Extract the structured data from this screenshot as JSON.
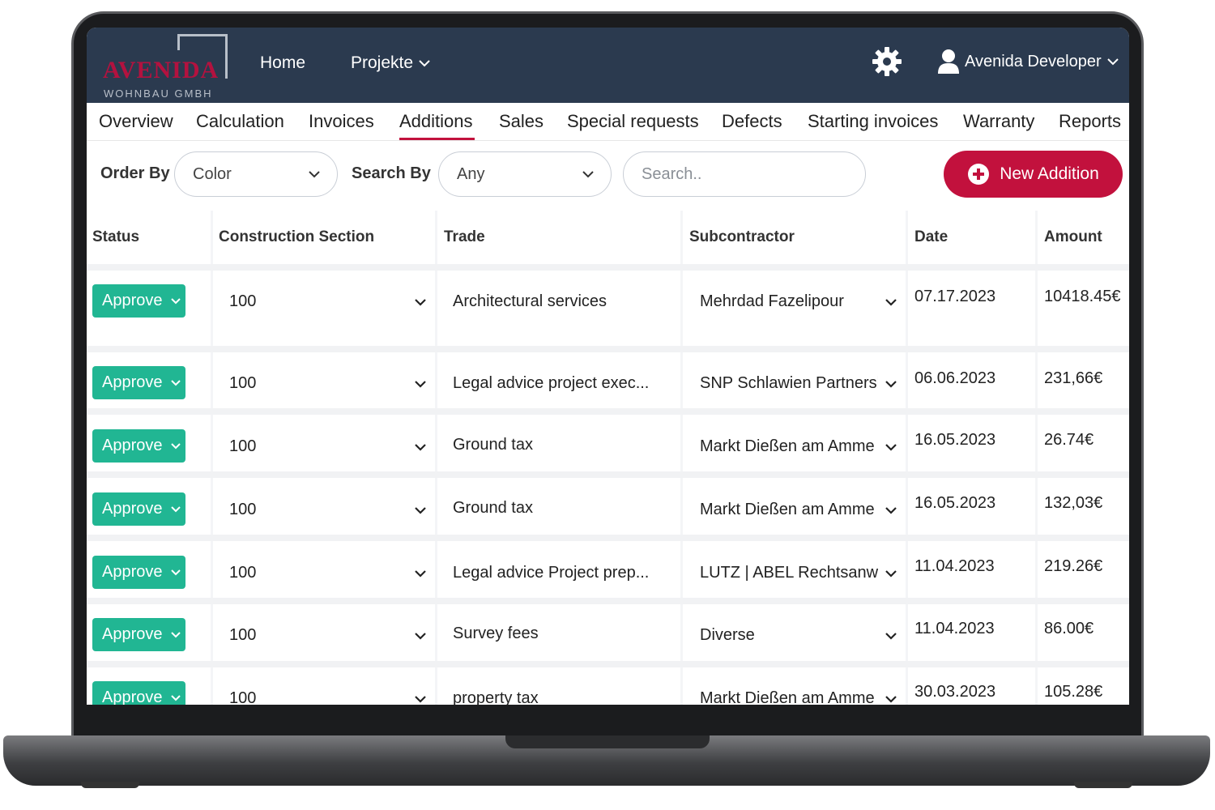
{
  "brand": {
    "name": "AVENIDA",
    "subtitle": "WOHNBAU GMBH"
  },
  "nav": {
    "home": "Home",
    "projects": "Projekte",
    "user": "Avenida Developer"
  },
  "tabs": [
    "Overview",
    "Calculation",
    "Invoices",
    "Additions",
    "Sales",
    "Special requests",
    "Defects",
    "Starting invoices",
    "Warranty",
    "Reports"
  ],
  "active_tab": "Additions",
  "toolbar": {
    "order_by_label": "Order By",
    "order_by_value": "Color",
    "search_by_label": "Search By",
    "search_by_value": "Any",
    "search_placeholder": "Search..",
    "new_button": "New Addition"
  },
  "table": {
    "columns": [
      "Status",
      "Construction Section",
      "Trade",
      "Subcontractor",
      "Date",
      "Amount"
    ],
    "rows": [
      {
        "status": "Approve",
        "section": "100",
        "trade": "Architectural services",
        "subcontractor": "Mehrdad Fazelipour",
        "date": "07.17.2023",
        "amount": "10418.45€"
      },
      {
        "status": "Approve",
        "section": "100",
        "trade": "Legal advice project exec...",
        "subcontractor": "SNP Schlawien Partnersl",
        "date": "06.06.2023",
        "amount": "231,66€"
      },
      {
        "status": "Approve",
        "section": "100",
        "trade": "Ground tax",
        "subcontractor": "Markt Dießen am Amme",
        "date": "16.05.2023",
        "amount": "26.74€"
      },
      {
        "status": "Approve",
        "section": "100",
        "trade": "Ground tax",
        "subcontractor": "Markt Dießen am Amme",
        "date": "16.05.2023",
        "amount": "132,03€"
      },
      {
        "status": "Approve",
        "section": "100",
        "trade": "Legal advice Project prep...",
        "subcontractor": "LUTZ | ABEL Rechtsanwa",
        "date": "11.04.2023",
        "amount": "219.26€"
      },
      {
        "status": "Approve",
        "section": "100",
        "trade": "Survey fees",
        "subcontractor": "Diverse",
        "date": "11.04.2023",
        "amount": "86.00€"
      },
      {
        "status": "Approve",
        "section": "100",
        "trade": "property tax",
        "subcontractor": "Markt Dießen am Amme",
        "date": "30.03.2023",
        "amount": "105.28€"
      }
    ]
  },
  "colors": {
    "navbar": "#2b3a4f",
    "accent": "#c2113d",
    "approve": "#21b693"
  },
  "icons": {
    "settings": "gear-icon",
    "user": "user-icon",
    "add": "plus-circle-icon",
    "dropdown": "chevron-down-icon"
  }
}
